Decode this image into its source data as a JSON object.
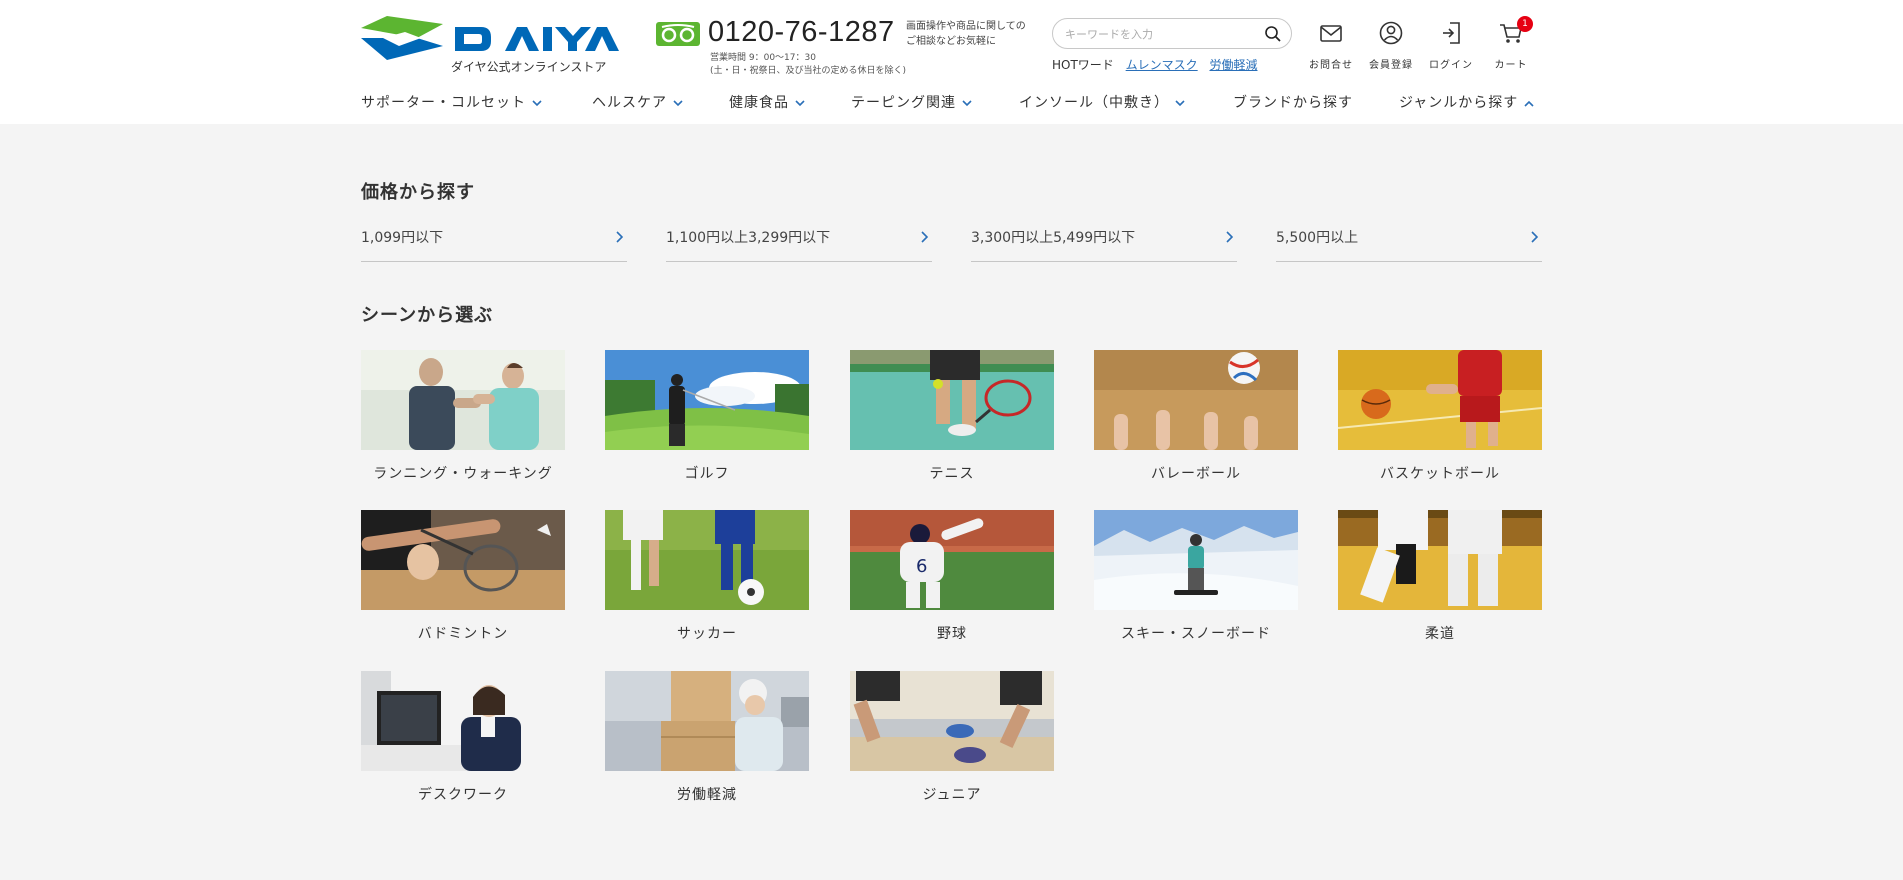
{
  "brand": {
    "name": "DAIYA",
    "subtitle": "ダイヤ公式オンラインストア",
    "colors": {
      "blue": "#0068b7",
      "green": "#5cb531"
    }
  },
  "contact": {
    "phone": "0120-76-1287",
    "note": "画面操作や商品に関しての\nご相談などお気軽に",
    "hours": "営業時間 9：00～17：30\n(土・日・祝祭日、及び当社の定める休日を除く)"
  },
  "search": {
    "placeholder": "キーワードを入力",
    "hot_label": "HOTワード",
    "hot_words": [
      "ムレンマスク",
      "労働軽減"
    ]
  },
  "utility": {
    "contact": "お問合せ",
    "register": "会員登録",
    "login": "ログイン",
    "cart": "カート",
    "cart_count": "1"
  },
  "nav": [
    {
      "label": "サポーター・コルセット",
      "chevron": "down"
    },
    {
      "label": "ヘルスケア",
      "chevron": "down"
    },
    {
      "label": "健康食品",
      "chevron": "down"
    },
    {
      "label": "テーピング関連",
      "chevron": "down"
    },
    {
      "label": "インソール（中敷き）",
      "chevron": "down"
    },
    {
      "label": "ブランドから探す",
      "chevron": "none"
    },
    {
      "label": "ジャンルから探す",
      "chevron": "up"
    }
  ],
  "price_section": {
    "title": "価格から探す",
    "items": [
      "1,099円以下",
      "1,100円以上3,299円以下",
      "3,300円以上5,499円以下",
      "5,500円以上"
    ]
  },
  "scene_section": {
    "title": "シーンから選ぶ",
    "items": [
      "ランニング・ウォーキング",
      "ゴルフ",
      "テニス",
      "バレーボール",
      "バスケットボール",
      "バドミントン",
      "サッカー",
      "野球",
      "スキー・スノーボード",
      "柔道",
      "デスクワーク",
      "労働軽減",
      "ジュニア"
    ]
  }
}
